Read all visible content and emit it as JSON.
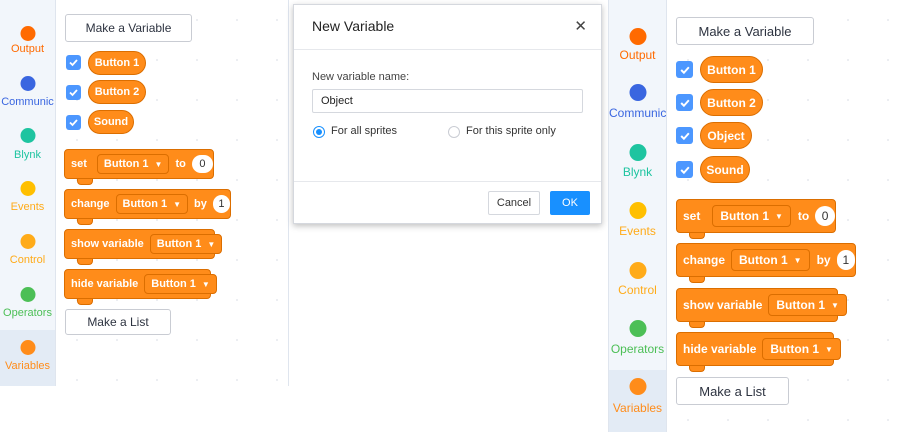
{
  "categories": [
    {
      "label": "Output",
      "color": "#ff6a00",
      "text_color": "#ff6a00"
    },
    {
      "label": "Communic",
      "color": "#3a66e0",
      "text_color": "#3a66e0"
    },
    {
      "label": "Blynk",
      "color": "#1ec4a0",
      "text_color": "#1ec4a0"
    },
    {
      "label": "Events",
      "color": "#ffbf00",
      "text_color": "#ffab19"
    },
    {
      "label": "Control",
      "color": "#ffab19",
      "text_color": "#ffab19"
    },
    {
      "label": "Operators",
      "color": "#4cbf56",
      "text_color": "#4cbf56"
    },
    {
      "label": "Variables",
      "color": "#ff8c1a",
      "text_color": "#ff8c1a"
    }
  ],
  "palette_before": {
    "make_variable": "Make a Variable",
    "variables": [
      "Button 1",
      "Button 2",
      "Sound"
    ],
    "make_list": "Make a List"
  },
  "palette_after": {
    "make_variable": "Make a Variable",
    "variables": [
      "Button 1",
      "Button 2",
      "Object",
      "Sound"
    ],
    "make_list": "Make a List"
  },
  "blocks": {
    "set": {
      "label": "set",
      "var": "Button 1",
      "to": "to",
      "value": "0"
    },
    "change": {
      "label": "change",
      "var": "Button 1",
      "by": "by",
      "value": "1"
    },
    "show": {
      "label": "show variable",
      "var": "Button 1"
    },
    "hide": {
      "label": "hide variable",
      "var": "Button 1"
    }
  },
  "dialog": {
    "title": "New Variable",
    "close": "✕",
    "name_label": "New variable name:",
    "name_value": "Object",
    "radio_all": "For all sprites",
    "radio_this": "For this sprite only",
    "cancel": "Cancel",
    "ok": "OK"
  }
}
